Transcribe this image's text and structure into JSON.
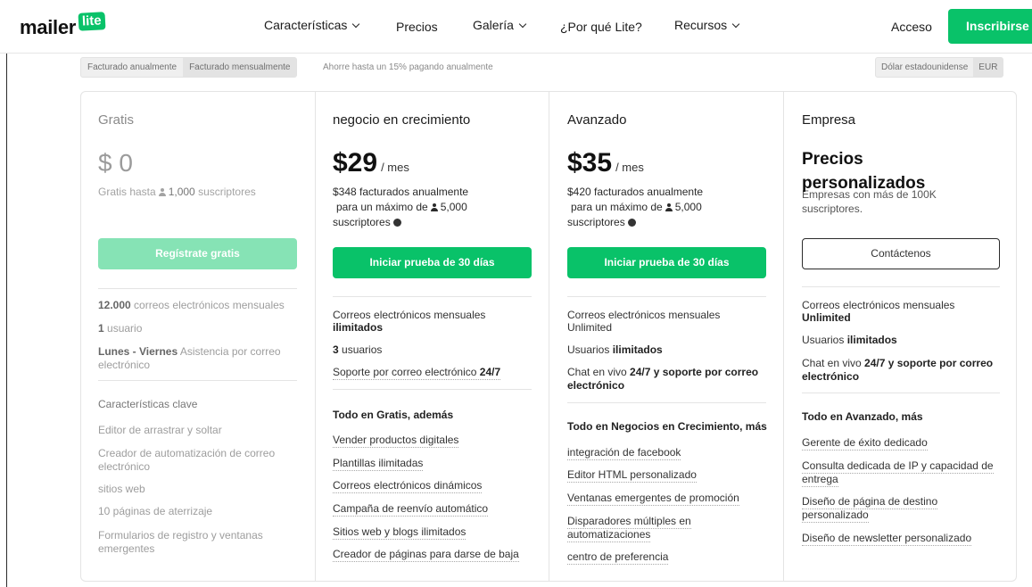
{
  "nav": {
    "logo_text": "mailer",
    "logo_box": "lite",
    "items": [
      "Características",
      "Precios",
      "Galería",
      "¿Por qué Lite?",
      "Recursos"
    ],
    "login": "Acceso",
    "signup": "Inscribirse"
  },
  "billing": {
    "annual": "Facturado anualmente",
    "monthly": "Facturado mensualmente",
    "savings_note": "Ahorre hasta un 15% pagando anualmente",
    "currency_usd": "Dólar estadounidense",
    "currency_eur": "EUR"
  },
  "plans": {
    "free": {
      "name": "Gratis",
      "price": "$ 0",
      "sub_pre": "Gratis hasta",
      "sub_count": "1,000",
      "sub_post": "suscriptores",
      "cta": "Regístrate gratis",
      "f1_bold": "12.000",
      "f1_rest": "correos electrónicos mensuales",
      "f2_bold": "1",
      "f2_rest": "usuario",
      "f3_bold": "Lunes - Viernes",
      "f3_rest": "Asistencia por correo electrónico",
      "key_head": "Características clave",
      "list": [
        "Editor de arrastrar y soltar",
        "Creador de automatización de correo electrónico",
        "sitios web",
        "10 páginas de aterrizaje",
        "Formularios de registro y ventanas emergentes"
      ]
    },
    "growing": {
      "name": "negocio en crecimiento",
      "price": "$29",
      "per": "/ mes",
      "billed": "$348 facturados anualmente",
      "max_pre": "para un máximo de",
      "max_count": "5,000",
      "max_post": "suscriptores",
      "cta": "Iniciar prueba de 30 días",
      "f1_text": "Correos electrónicos mensuales",
      "f1_bold": "ilimitados",
      "f2_bold": "3",
      "f2_rest": "usuarios",
      "f3_text": "Soporte por correo electrónico",
      "f3_bold": "24/7",
      "head": "Todo en Gratis, además",
      "list": [
        "Vender productos digitales",
        "Plantillas ilimitadas",
        "Correos electrónicos dinámicos",
        "Campaña de reenvío automático",
        "Sitios web y blogs ilimitados",
        "Creador de páginas para darse de baja"
      ]
    },
    "advanced": {
      "name": "Avanzado",
      "price": "$35",
      "per": "/ mes",
      "billed": "$420 facturados anualmente",
      "max_pre": "para un máximo de",
      "max_count": "5,000",
      "max_post": "suscriptores",
      "cta": "Iniciar prueba de 30 días",
      "f1_text": "Correos electrónicos mensuales",
      "f1_bold": "Unlimited",
      "f2_text": "Usuarios",
      "f2_bold": "ilimitados",
      "f3_text": "Chat en vivo",
      "f3_bold": "24/7 y soporte por correo electrónico",
      "head": "Todo en Negocios en Crecimiento, más",
      "list": [
        "integración de facebook",
        "Editor HTML personalizado",
        "Ventanas emergentes de promoción",
        "Disparadores múltiples en automatizaciones",
        "centro de preferencia"
      ]
    },
    "enterprise": {
      "name": "Empresa",
      "price_line1": "Precios",
      "price_line2": "personalizados",
      "sub": "Empresas con más de 100K suscriptores.",
      "cta": "Contáctenos",
      "f1_text": "Correos electrónicos mensuales",
      "f1_bold": "Unlimited",
      "f2_text": "Usuarios",
      "f2_bold": "ilimitados",
      "f3_text": "Chat en vivo",
      "f3_bold": "24/7 y soporte por correo electrónico",
      "head": "Todo en Avanzado, más",
      "list": [
        "Gerente de éxito dedicado",
        "Consulta dedicada de IP y capacidad de entrega",
        "Diseño de página de destino personalizado",
        "Diseño de newsletter personalizado"
      ]
    }
  },
  "colors": {
    "brand_green": "#09c269",
    "pale_green": "#86e3b5"
  }
}
